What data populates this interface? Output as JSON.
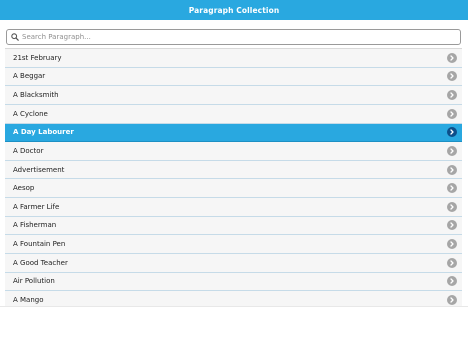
{
  "header": {
    "title": "Paragraph Collection"
  },
  "search": {
    "placeholder": "Search Paragraph..."
  },
  "list": {
    "items": [
      {
        "label": "21st February",
        "active": false
      },
      {
        "label": "A Beggar",
        "active": false
      },
      {
        "label": "A Blacksmith",
        "active": false
      },
      {
        "label": "A Cyclone",
        "active": false
      },
      {
        "label": "A Day Labourer",
        "active": true
      },
      {
        "label": "A Doctor",
        "active": false
      },
      {
        "label": "Advertisement",
        "active": false
      },
      {
        "label": "Aesop",
        "active": false
      },
      {
        "label": "A Farmer Life",
        "active": false
      },
      {
        "label": "A Fisherman",
        "active": false
      },
      {
        "label": "A Fountain Pen",
        "active": false
      },
      {
        "label": "A Good Teacher",
        "active": false
      },
      {
        "label": "Air Pollution",
        "active": false
      },
      {
        "label": "A Mango",
        "active": false
      }
    ]
  },
  "colors": {
    "header_bg": "#29a8e0",
    "active_row_bg": "#29a8e0",
    "row_bg": "#f6f6f6",
    "chevron_bg": "#a6a6a6",
    "active_chevron_bg": "#0d4f8a"
  },
  "icons": {
    "search": "search-icon",
    "row_action": "chevron-right-icon"
  }
}
